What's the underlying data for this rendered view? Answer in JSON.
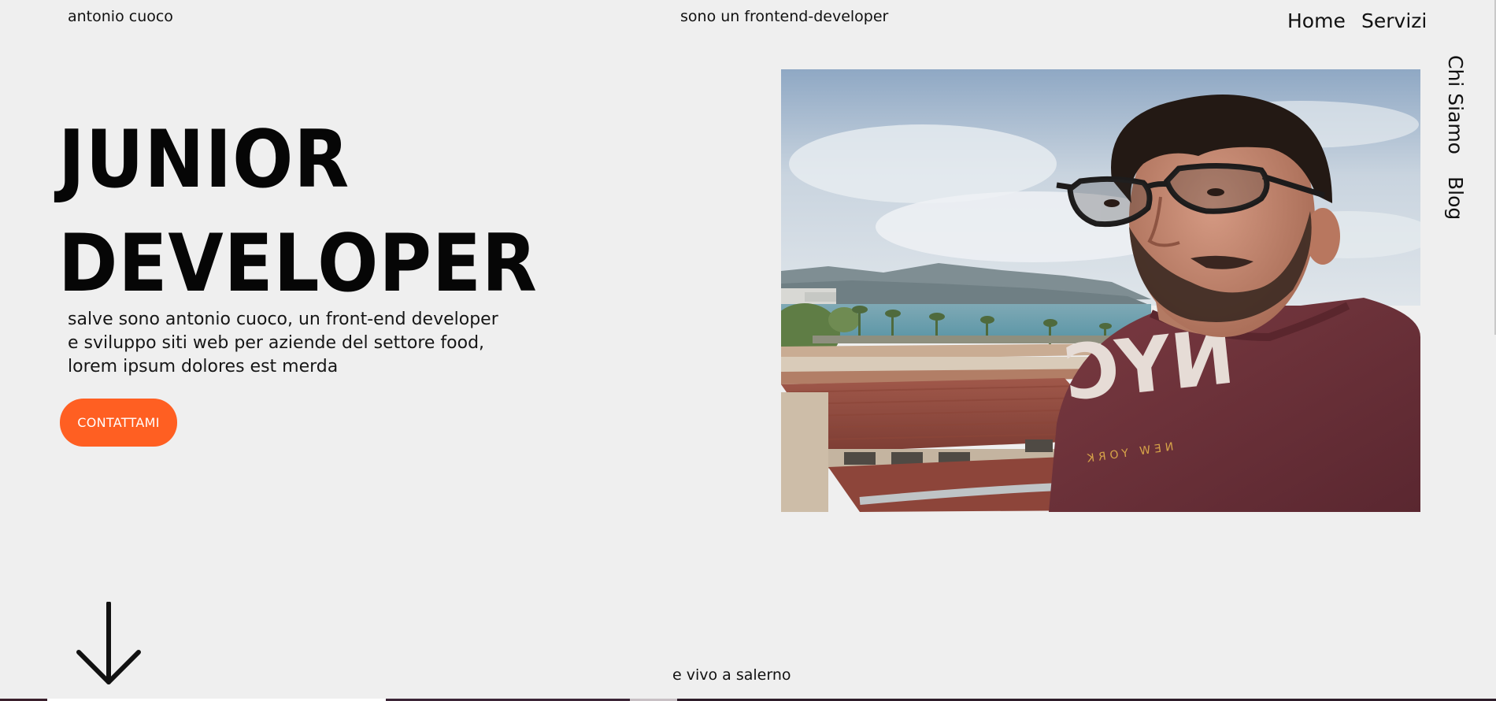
{
  "header": {
    "site_name": "antonio cuoco",
    "tagline": "sono un frontend-developer"
  },
  "nav": {
    "home": "Home",
    "servizi": "Servizi"
  },
  "side_nav": {
    "chi_siamo": "Chi Siamo",
    "blog": "Blog"
  },
  "hero": {
    "title_line1": "JUNIOR",
    "title_line2": "DEVELOPER",
    "intro_line1": "salve sono antonio cuoco, un front-end developer",
    "intro_line2": "e sviluppo siti web per aziende del settore food,",
    "intro_line3": "lorem ipsum dolores est merda",
    "cta_label": "CONTATTAMI"
  },
  "photo": {
    "shirt_text": "NYC",
    "shirt_subtext": "NEW YORK"
  },
  "footer": {
    "location": "e vivo a salerno"
  },
  "colors": {
    "background": "#efefef",
    "accent": "#ff5f22",
    "text": "#111111"
  },
  "icons": {
    "scroll": "arrow-down-icon"
  }
}
